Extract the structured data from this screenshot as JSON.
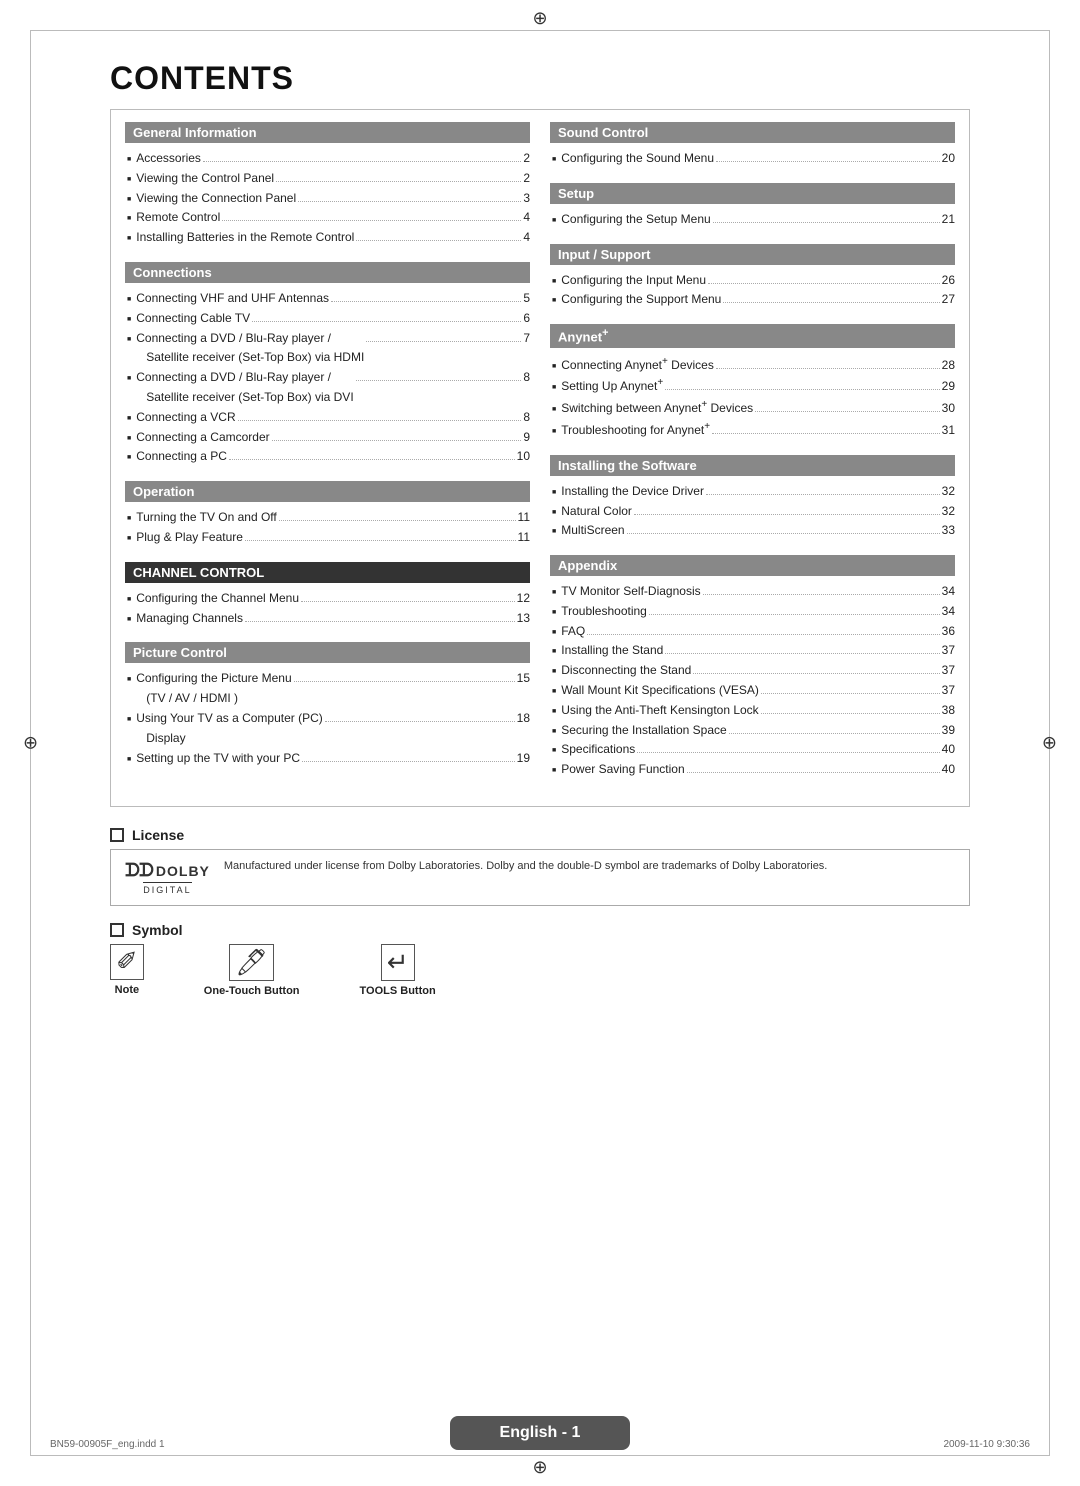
{
  "page": {
    "title": "CONTENTS",
    "footer_text": "English - 1",
    "footer_left": "BN59-00905F_eng.indd  1",
    "footer_right": "2009-11-10  9:30:36",
    "top_symbol": "⊕",
    "bottom_symbol": "⊕"
  },
  "left_col": {
    "sections": [
      {
        "id": "general-information",
        "header": "General Information",
        "header_style": "medium",
        "items": [
          {
            "label": "Accessories",
            "dots": true,
            "page": "2"
          },
          {
            "label": "Viewing the Control Panel",
            "dots": true,
            "page": "2"
          },
          {
            "label": "Viewing the Connection Panel",
            "dots": true,
            "page": "3"
          },
          {
            "label": "Remote Control",
            "dots": true,
            "page": "4"
          },
          {
            "label": "Installing Batteries in the Remote Control",
            "dots": true,
            "page": "4"
          }
        ]
      },
      {
        "id": "connections",
        "header": "Connections",
        "header_style": "medium",
        "items": [
          {
            "label": "Connecting VHF and UHF Antennas",
            "dots": true,
            "page": "5"
          },
          {
            "label": "Connecting Cable TV",
            "dots": true,
            "page": "6"
          },
          {
            "label": "Connecting a DVD / Blu-Ray player / Satellite receiver (Set-Top Box) via HDMI",
            "dots": true,
            "page": "7"
          },
          {
            "label": "Connecting a DVD / Blu-Ray player / Satellite receiver (Set-Top Box) via DVI",
            "dots": true,
            "page": "8"
          },
          {
            "label": "Connecting a VCR",
            "dots": true,
            "page": "8"
          },
          {
            "label": "Connecting a Camcorder",
            "dots": true,
            "page": "9"
          },
          {
            "label": "Connecting a PC",
            "dots": true,
            "page": "10"
          }
        ]
      },
      {
        "id": "operation",
        "header": "Operation",
        "header_style": "medium",
        "items": [
          {
            "label": "Turning the TV On and Off",
            "dots": true,
            "page": "11"
          },
          {
            "label": "Plug & Play Feature",
            "dots": true,
            "page": "11"
          }
        ]
      },
      {
        "id": "channel-control",
        "header": "CHANNEL CONTROL",
        "header_style": "dark",
        "items": [
          {
            "label": "Configuring the Channel Menu",
            "dots": true,
            "page": "12"
          },
          {
            "label": "Managing Channels",
            "dots": true,
            "page": "13"
          }
        ]
      },
      {
        "id": "picture-control",
        "header": "Picture Control",
        "header_style": "medium",
        "items": [
          {
            "label": "Configuring the Picture Menu (TV / AV / HDMI )",
            "dots": true,
            "page": "15"
          },
          {
            "label": "Using Your TV as a Computer (PC) Display",
            "dots": true,
            "page": "18"
          },
          {
            "label": "Setting up the TV with your PC",
            "dots": true,
            "page": "19"
          }
        ]
      }
    ]
  },
  "right_col": {
    "sections": [
      {
        "id": "sound-control",
        "header": "Sound Control",
        "header_style": "medium",
        "items": [
          {
            "label": "Configuring the Sound Menu",
            "dots": true,
            "page": "20"
          }
        ]
      },
      {
        "id": "setup",
        "header": "Setup",
        "header_style": "medium",
        "items": [
          {
            "label": "Configuring the Setup Menu",
            "dots": true,
            "page": "21"
          }
        ]
      },
      {
        "id": "input-support",
        "header": "Input / Support",
        "header_style": "medium",
        "items": [
          {
            "label": "Configuring the Input Menu",
            "dots": true,
            "page": "26"
          },
          {
            "label": "Configuring the Support Menu",
            "dots": true,
            "page": "27"
          }
        ]
      },
      {
        "id": "anynet",
        "header": "Anynet⁺",
        "header_style": "medium",
        "items": [
          {
            "label": "Connecting Anynet⁺ Devices",
            "dots": true,
            "page": "28"
          },
          {
            "label": "Setting Up Anynet⁺",
            "dots": true,
            "page": "29"
          },
          {
            "label": "Switching between Anynet⁺ Devices",
            "dots": true,
            "page": "30"
          },
          {
            "label": "Troubleshooting for Anynet⁺",
            "dots": true,
            "page": "31"
          }
        ]
      },
      {
        "id": "installing-software",
        "header": "Installing the Software",
        "header_style": "medium",
        "items": [
          {
            "label": "Installing the Device Driver",
            "dots": true,
            "page": "32"
          },
          {
            "label": "Natural Color",
            "dots": true,
            "page": "32"
          },
          {
            "label": "MultiScreen",
            "dots": true,
            "page": "33"
          }
        ]
      },
      {
        "id": "appendix",
        "header": "Appendix",
        "header_style": "medium",
        "items": [
          {
            "label": "TV Monitor Self-Diagnosis",
            "dots": true,
            "page": "34"
          },
          {
            "label": "Troubleshooting",
            "dots": true,
            "page": "34"
          },
          {
            "label": "FAQ",
            "dots": true,
            "page": "36"
          },
          {
            "label": "Installing the Stand",
            "dots": true,
            "page": "37"
          },
          {
            "label": "Disconnecting the Stand",
            "dots": true,
            "page": "37"
          },
          {
            "label": "Wall Mount Kit Specifications (VESA)",
            "dots": true,
            "page": "37"
          },
          {
            "label": "Using the Anti-Theft Kensington Lock",
            "dots": true,
            "page": "38"
          },
          {
            "label": "Securing the Installation Space",
            "dots": true,
            "page": "39"
          },
          {
            "label": "Specifications",
            "dots": true,
            "page": "40"
          },
          {
            "label": "Power Saving Function",
            "dots": true,
            "page": "40"
          }
        ]
      }
    ]
  },
  "license": {
    "section_label": "License",
    "dolby_brand": "DOLBY",
    "dolby_sub": "DIGITAL",
    "license_text": "Manufactured under license from Dolby Laboratories. Dolby and the double-D symbol are trademarks of Dolby Laboratories."
  },
  "symbol": {
    "section_label": "Symbol",
    "items": [
      {
        "icon": "✏",
        "label": "Note"
      },
      {
        "icon": "🖊",
        "label": "One-Touch Button"
      },
      {
        "icon": "↵",
        "label": "TOOLS Button"
      }
    ]
  }
}
